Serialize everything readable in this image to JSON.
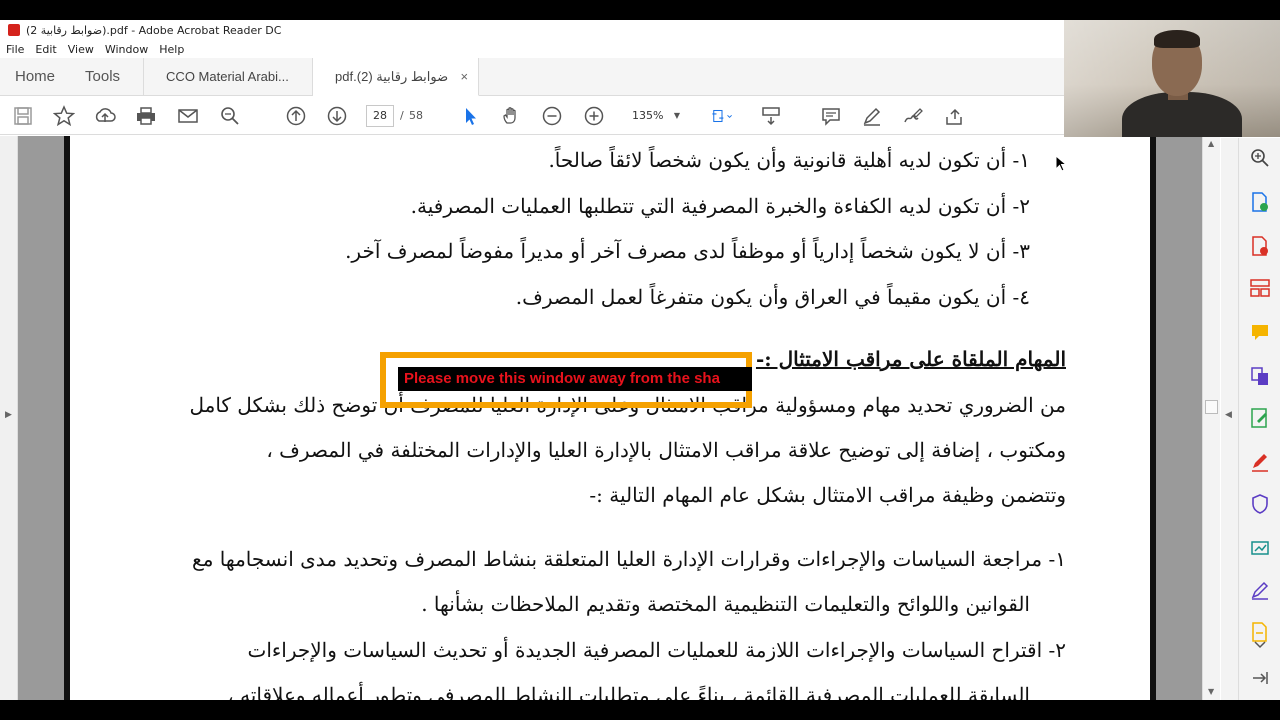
{
  "window": {
    "title": "(ضوابط رقابية 2).pdf - Adobe Acrobat Reader DC"
  },
  "menu": [
    "File",
    "Edit",
    "View",
    "Window",
    "Help"
  ],
  "tabs": {
    "home": "Home",
    "tools": "Tools",
    "doc1": "CCO Material Arabi...",
    "doc2": "ضوابط رقابية (2).pdf",
    "close": "×"
  },
  "toolbar": {
    "current_page": "28",
    "separator": "/",
    "total_pages": "58",
    "zoom": "135%",
    "icons": [
      "save-icon",
      "bookmark-star-icon",
      "upload-icon",
      "print-icon",
      "email-icon",
      "search-icon",
      "page-up-icon",
      "page-down-icon",
      "select-cursor-icon",
      "hand-icon",
      "zoom-out-icon",
      "zoom-in-icon",
      "fit-page-icon",
      "scroll-mode-icon",
      "comment-icon",
      "highlight-pen-icon",
      "sign-icon",
      "share-icon"
    ]
  },
  "document": {
    "lines": [
      "١- أن تكون لديه أهلية قانونية وأن يكون شخصاً لائقاً صالحاً.",
      "٢- أن تكون لديه الكفاءة والخبرة المصرفية التي تتطلبها العمليات المصرفية.",
      "٣- أن لا يكون شخصاً إدارياً أو موظفاً لدى مصرف آخر أو مديراً مفوضاً لمصرف آخر.",
      "٤- أن يكون مقيماً في العراق وأن يكون متفرغاً لعمل المصرف."
    ],
    "heading": "المهام الملقاة على مراقب الامتثال :-",
    "paragraph": [
      "من الضروري تحديد مهام ومسؤولية مراقب الامتثال وعلى الإدارة العليا للمصرف أن توضح ذلك بشكل كامل",
      "ومكتوب ، إضافة إلى توضيح علاقة مراقب الامتثال بالإدارة العليا والإدارات المختلفة في المصرف ،",
      "وتتضمن وظيفة مراقب الامتثال بشكل عام المهام التالية :-"
    ],
    "item1": [
      "١- مراجعة السياسات والإجراءات وقرارات الإدارة العليا المتعلقة بنشاط المصرف وتحديد مدى انسجامها مع",
      "القوانين واللوائح والتعليمات التنظيمية المختصة وتقديم الملاحظات بشأنها ."
    ],
    "item2": [
      "٢- اقتراح السياسات والإجراءات اللازمة للعمليات المصرفية الجديدة أو تحديث السياسات والإجراءات",
      "السابقة للعمليات المصرفية القائمة ، بناءً على متطلبات النشاط المصرفي وتطور أعماله وعلاقاته ،"
    ]
  },
  "overlay": {
    "warning": "Please move this window away from the sha"
  },
  "right_panel_icons": [
    "search-zoom-icon",
    "export-pdf-icon",
    "create-pdf-icon",
    "organize-pages-icon",
    "comment-tool-icon",
    "combine-files-icon",
    "edit-pdf-icon",
    "fill-sign-icon",
    "protect-icon",
    "send-track-icon",
    "more-tools-icon",
    "scan-icon",
    "expand-icon"
  ],
  "colors": {
    "accent": "#1a73e8",
    "warning_border": "#f5a100",
    "warning_text": "#e8121c"
  }
}
